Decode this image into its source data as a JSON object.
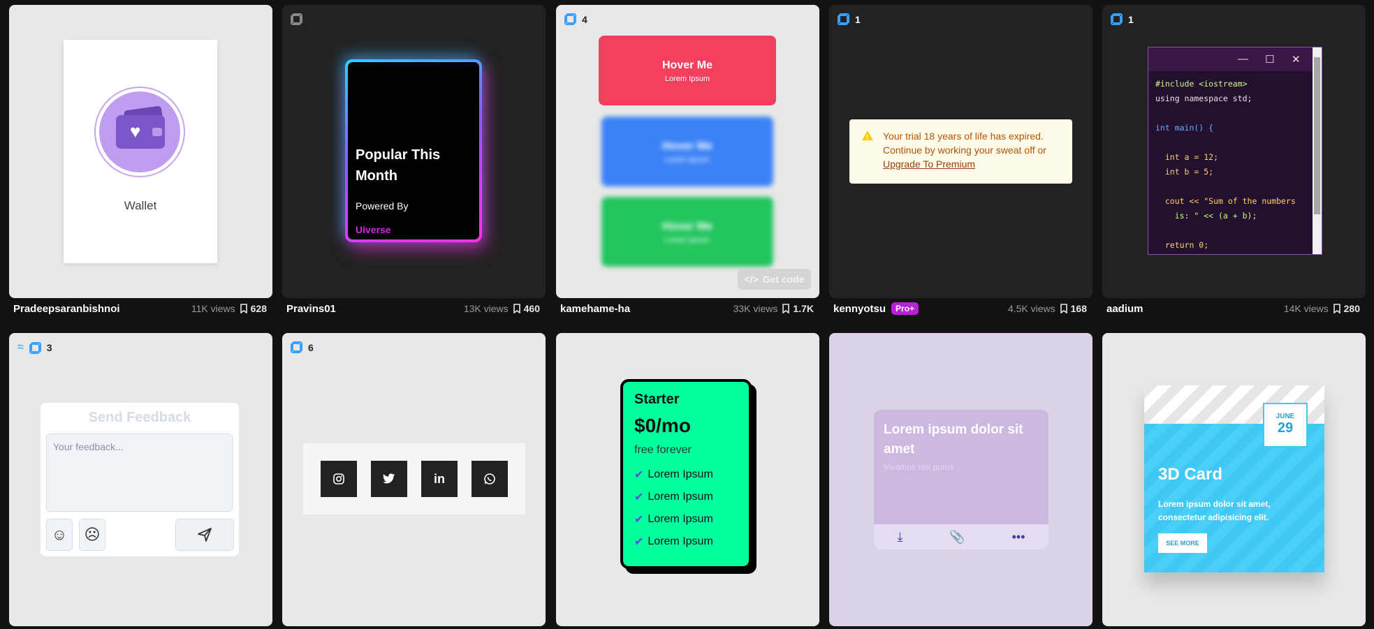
{
  "cards": [
    {
      "author": "Pradeepsaranbishnoi",
      "views": "11K views",
      "saves": "628",
      "label": "Wallet"
    },
    {
      "author": "Pravins01",
      "views": "13K views",
      "saves": "460",
      "title": "Popular This Month",
      "subtitle": "Powered By",
      "brand": "Uiverse"
    },
    {
      "author": "kamehame-ha",
      "views": "33K views",
      "saves": "1.7K",
      "count": "4",
      "buttons": [
        {
          "title": "Hover Me",
          "sub": "Lorem Ipsum"
        },
        {
          "title": "Hover Me",
          "sub": "Lorem Ipsum"
        },
        {
          "title": "Hover Me",
          "sub": "Lorem Ipsum"
        }
      ],
      "get_code": "Get code"
    },
    {
      "author": "kennyotsu",
      "badge": "Pro+",
      "views": "4.5K views",
      "saves": "168",
      "count": "1",
      "alert_text": "Your trial 18 years of life has expired. Continue by working your sweat off or",
      "alert_link": "Upgrade To Premium"
    },
    {
      "author": "aadium",
      "views": "14K views",
      "saves": "280",
      "count": "1",
      "code": [
        "#include <iostream>",
        "using namespace std;",
        "",
        "int main() {",
        "",
        "  int a = 12;",
        "  int b = 5;",
        "",
        "  cout << \"Sum of the numbers",
        "    is: \" << (a + b);",
        "",
        "  return 0;"
      ]
    },
    {
      "count": "3",
      "title": "Send Feedback",
      "placeholder": "Your feedback..."
    },
    {
      "count": "6"
    },
    {
      "plan": "Starter",
      "price": "$0/mo",
      "period": "free forever",
      "features": [
        "Lorem Ipsum",
        "Lorem Ipsum",
        "Lorem Ipsum",
        "Lorem Ipsum"
      ]
    },
    {
      "title": "Lorem ipsum dolor sit amet",
      "subtitle": "Vivamus nisi purus"
    },
    {
      "month": "JUNE",
      "day": "29",
      "title": "3D Card",
      "desc": "Lorem ipsum dolor sit amet, consectetur adipisicing elit.",
      "cta": "SEE MORE"
    }
  ],
  "colors": {
    "accent_blue": "#3aa0ff",
    "pro_badge": "#b91fd6",
    "pricing_green": "#00ff9d",
    "hover_red": "#f43f5e"
  },
  "icons": [
    "copy-icon",
    "bookmark-icon",
    "wallet-icon",
    "heart-icon",
    "warning-icon",
    "minimize-icon",
    "maximize-icon",
    "close-icon",
    "tailwind-icon",
    "smile-icon",
    "frown-icon",
    "send-icon",
    "instagram-icon",
    "twitter-icon",
    "linkedin-icon",
    "whatsapp-icon",
    "check-icon",
    "download-icon",
    "paperclip-icon",
    "more-icon",
    "code-icon"
  ]
}
